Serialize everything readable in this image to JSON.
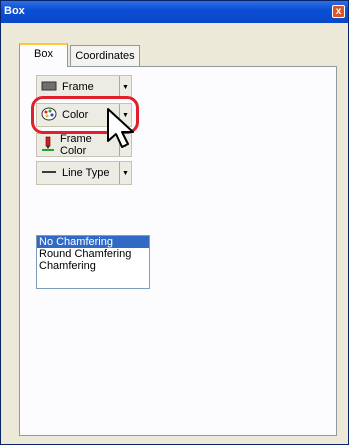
{
  "window": {
    "title": "Box",
    "close_glyph": "x"
  },
  "tabs": [
    {
      "label": "Box",
      "active": true
    },
    {
      "label": "Coordinates",
      "active": false
    }
  ],
  "toolbar": {
    "frame_label": "Frame",
    "color_label": "Color",
    "frame_color_label": "Frame Color",
    "line_type_label": "Line Type",
    "icons": [
      "frame-swatch-icon",
      "palette-icon",
      "pen-icon",
      "line-icon",
      "dropdown-arrow-icon"
    ]
  },
  "chamfer_list": {
    "items": [
      "No Chamfering",
      "Round Chamfering",
      "Chamfering"
    ],
    "selected": "No Chamfering"
  },
  "colors": {
    "title_bar": "#0a46c8",
    "highlight": "#e0202a",
    "selection": "#316ac5",
    "tab_accent": "#ffc83c"
  }
}
